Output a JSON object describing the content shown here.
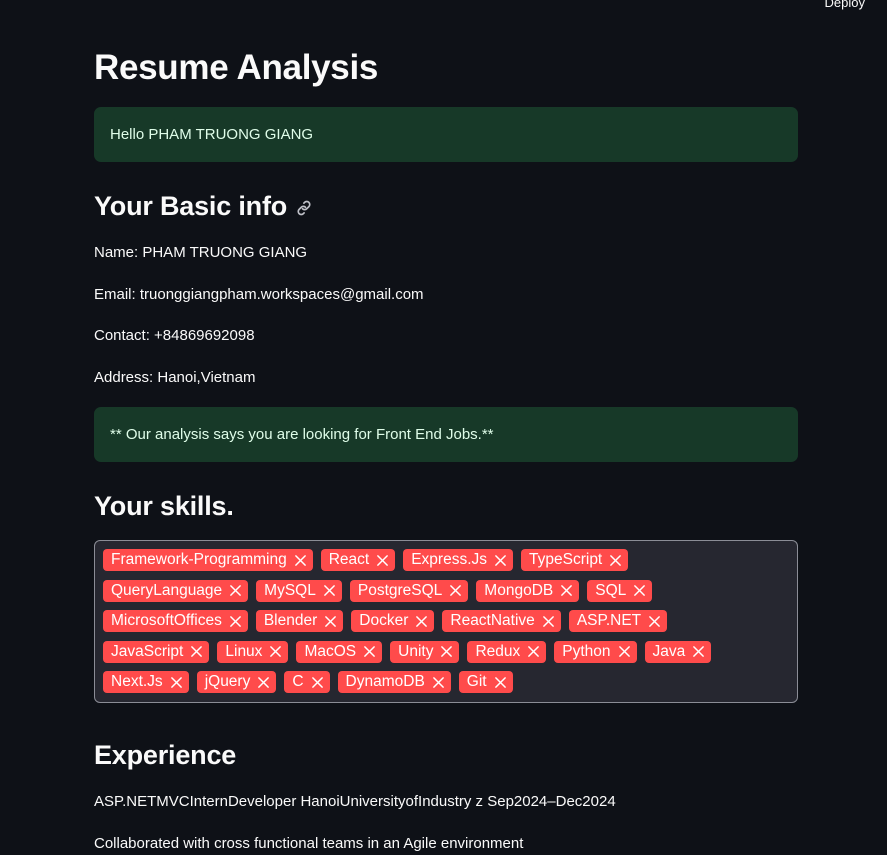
{
  "header": {
    "deploy_label": "Deploy"
  },
  "page": {
    "title": "Resume Analysis"
  },
  "greeting": "Hello PHAM TRUONG GIANG",
  "basic_info": {
    "heading": "Your Basic info",
    "link_icon": "link-icon",
    "name": "Name: PHAM TRUONG GIANG",
    "email": "Email: truonggiangpham.workspaces@gmail.com",
    "contact": "Contact: +84869692098",
    "address": "Address: Hanoi,Vietnam"
  },
  "analysis_message": "** Our analysis says you are looking for Front End Jobs.**",
  "skills": {
    "heading": "Your skills.",
    "tag_color": "#ff4b4b",
    "rows": [
      [
        "Framework-Programming",
        "React",
        "Express.Js",
        "TypeScript"
      ],
      [
        "QueryLanguage",
        "MySQL",
        "PostgreSQL",
        "MongoDB",
        "SQL"
      ],
      [
        "MicrosoftOffices",
        "Blender",
        "Docker",
        "ReactNative",
        "ASP.NET"
      ],
      [
        "JavaScript",
        "Linux",
        "MacOS",
        "Unity",
        "Redux",
        "Python",
        "Java"
      ],
      [
        "Next.Js",
        "jQuery",
        "C",
        "DynamoDB",
        "Git"
      ]
    ]
  },
  "experience": {
    "heading": "Experience",
    "lines": [
      "ASP.NETMVCInternDeveloper HanoiUniversityofIndustry z Sep2024–Dec2024",
      "Collaborated with cross functional teams in an Agile environment"
    ]
  },
  "colors": {
    "background": "#0e1117",
    "success_bg": "#173928",
    "success_text": "#dffde9",
    "input_bg": "#262730"
  }
}
